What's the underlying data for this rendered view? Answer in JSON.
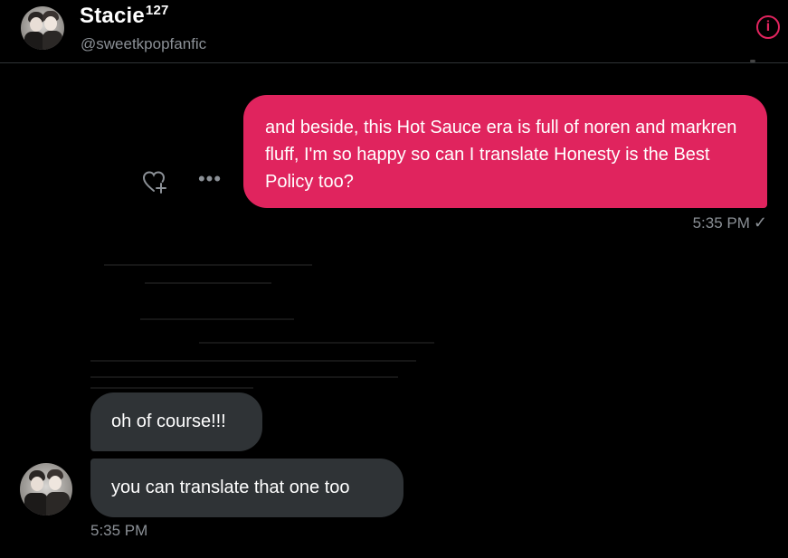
{
  "header": {
    "name": "Stacie",
    "name_superscript": "127",
    "handle": "@sweetkpopfanfic",
    "info_icon": "info-icon"
  },
  "messages": [
    {
      "direction": "outgoing",
      "text": "and beside, this Hot Sauce era is full of noren and markren fluff, I'm so happy so can I translate Honesty is the Best Policy too?",
      "time": "5:35 PM",
      "status_icon": "checkmark-icon",
      "actions": [
        "add-reaction-icon",
        "more-options-icon"
      ]
    },
    {
      "direction": "incoming",
      "text": "oh of course!!!"
    },
    {
      "direction": "incoming",
      "text": "you can translate that one too",
      "time": "5:35 PM"
    }
  ],
  "colors": {
    "background": "#000000",
    "accent": "#e0245e",
    "incoming_bubble": "#2f3336",
    "muted_text": "#8b9096"
  }
}
